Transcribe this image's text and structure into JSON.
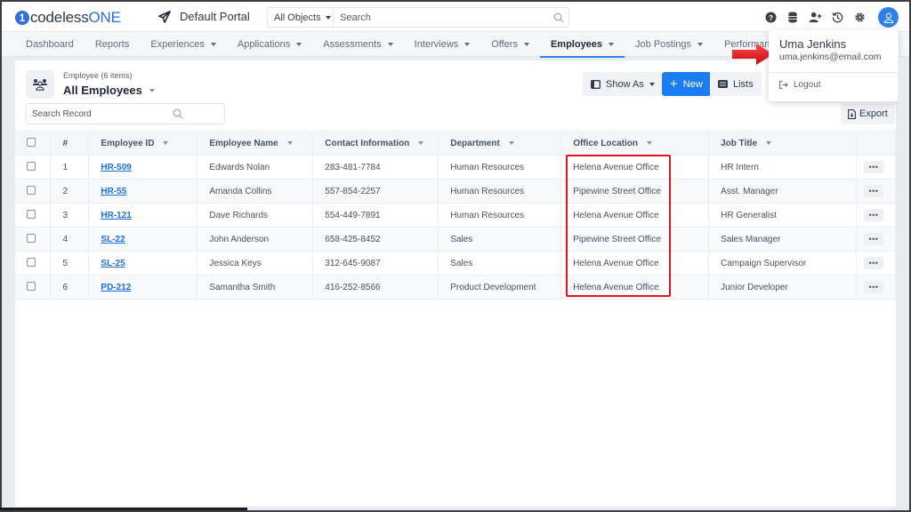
{
  "app": {
    "logo_mark": "1",
    "logo_prefix": "codeless",
    "logo_suffix": "ONE",
    "portal": "Default Portal"
  },
  "global_search": {
    "scope": "All Objects",
    "placeholder": "Search"
  },
  "top_icons": [
    "help-icon",
    "database-icon",
    "add-user-icon",
    "history-icon",
    "gear-icon",
    "user-avatar-icon"
  ],
  "nav": {
    "items": [
      {
        "label": "Dashboard",
        "dropdown": false,
        "active": false
      },
      {
        "label": "Reports",
        "dropdown": false,
        "active": false
      },
      {
        "label": "Experiences",
        "dropdown": true,
        "active": false
      },
      {
        "label": "Applications",
        "dropdown": true,
        "active": false
      },
      {
        "label": "Assessments",
        "dropdown": true,
        "active": false
      },
      {
        "label": "Interviews",
        "dropdown": true,
        "active": false
      },
      {
        "label": "Offers",
        "dropdown": true,
        "active": false
      },
      {
        "label": "Employees",
        "dropdown": true,
        "active": true
      },
      {
        "label": "Job Postings",
        "dropdown": true,
        "active": false
      },
      {
        "label": "Performance",
        "dropdown": true,
        "active": false
      }
    ]
  },
  "list": {
    "subtitle": "Employee (6 items)",
    "title": "All Employees",
    "search_placeholder": "Search Record",
    "buttons": {
      "show_as": "Show As",
      "new": "New",
      "lists": "Lists",
      "export": "Export"
    }
  },
  "table": {
    "columns": [
      "#",
      "Employee ID",
      "Employee Name",
      "Contact Information",
      "Department",
      "Office Location",
      "Job Title"
    ],
    "rows": [
      {
        "num": "1",
        "id": "HR-509",
        "name": "Edwards Nolan",
        "contact": "283-481-7784",
        "department": "Human Resources",
        "office": "Helena Avenue Office",
        "title": "HR Intern"
      },
      {
        "num": "2",
        "id": "HR-55",
        "name": "Amanda Collins",
        "contact": "557-854-2257",
        "department": "Human Resources",
        "office": "Pipewine Street Office",
        "title": "Asst. Manager"
      },
      {
        "num": "3",
        "id": "HR-121",
        "name": "Dave Richards",
        "contact": "554-449-7891",
        "department": "Human Resources",
        "office": "Helena Avenue Office",
        "title": "HR Generalist"
      },
      {
        "num": "4",
        "id": "SL-22",
        "name": "John Anderson",
        "contact": "658-425-8452",
        "department": "Sales",
        "office": "Pipewine Street Office",
        "title": "Sales Manager"
      },
      {
        "num": "5",
        "id": "SL-25",
        "name": "Jessica Keys",
        "contact": "312-645-9087",
        "department": "Sales",
        "office": "Helena Avenue Office",
        "title": "Campaign Supervisor"
      },
      {
        "num": "6",
        "id": "PD-212",
        "name": "Samantha Smith",
        "contact": "416-252-8566",
        "department": "Product Development",
        "office": "Helena Avenue Office",
        "title": "Junior Developer"
      }
    ],
    "row_action": "•••"
  },
  "user_menu": {
    "name": "Uma Jenkins",
    "email": "uma.jenkins@email.com",
    "logout": "Logout"
  },
  "colors": {
    "accent": "#1d7cf2",
    "highlight": "#e0141e",
    "arrow": "#e8141c"
  }
}
